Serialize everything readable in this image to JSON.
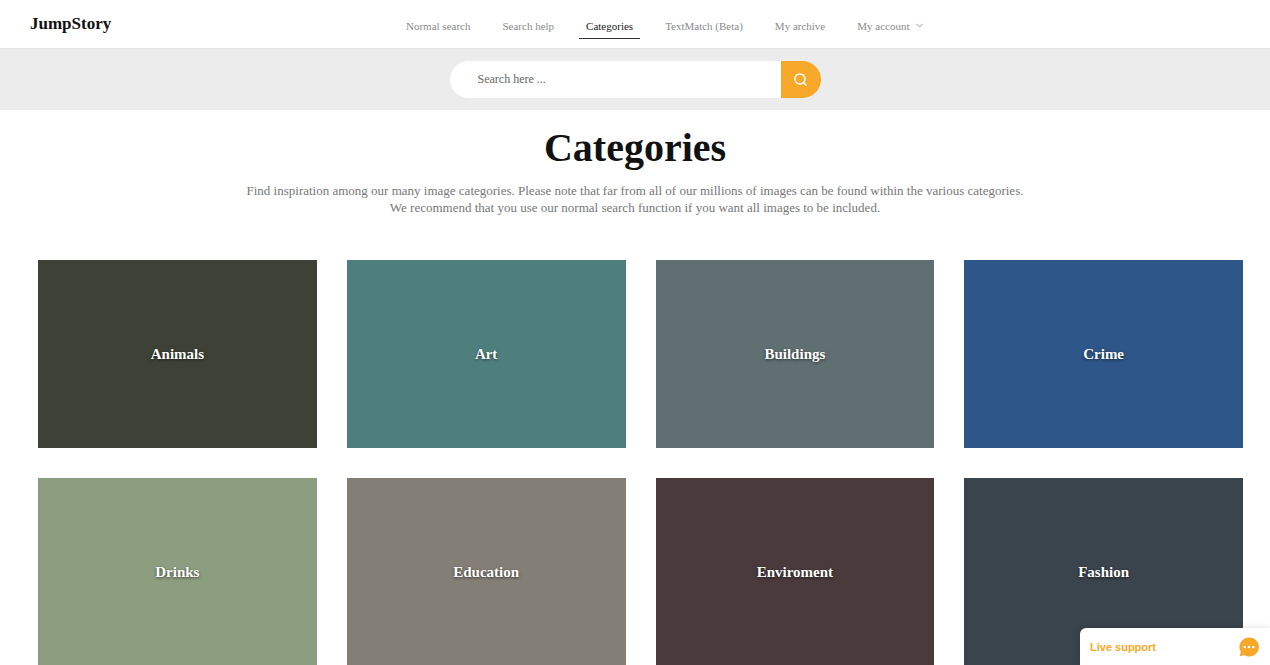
{
  "header": {
    "logo": "JumpStory",
    "nav": [
      {
        "label": "Normal search",
        "selected": false,
        "kind": "link"
      },
      {
        "label": "Search help",
        "selected": false,
        "kind": "link"
      },
      {
        "label": "Categories",
        "selected": true,
        "kind": "link"
      },
      {
        "label": "TextMatch (Beta)",
        "selected": false,
        "kind": "link"
      },
      {
        "label": "My archive",
        "selected": false,
        "kind": "link"
      },
      {
        "label": "My account",
        "selected": false,
        "kind": "menu"
      }
    ]
  },
  "search": {
    "placeholder": "Search here ..."
  },
  "page": {
    "title": "Categories",
    "description": "Find inspiration among our many image categories. Please note that far from all of our millions of images can be found within the various categories. We recommend that you use our normal search function if you want all images to be included."
  },
  "categories": [
    {
      "name": "Animals",
      "color": "#3e4136"
    },
    {
      "name": "Art",
      "color": "#4f7f7c"
    },
    {
      "name": "Buildings",
      "color": "#5f6f72"
    },
    {
      "name": "Crime",
      "color": "#2e5688"
    },
    {
      "name": "Drinks",
      "color": "#8d9d7f"
    },
    {
      "name": "Education",
      "color": "#847f76"
    },
    {
      "name": "Enviroment",
      "color": "#4a3a3c"
    },
    {
      "name": "Fashion",
      "color": "#3a444c"
    }
  ],
  "support": {
    "label": "Live support"
  }
}
